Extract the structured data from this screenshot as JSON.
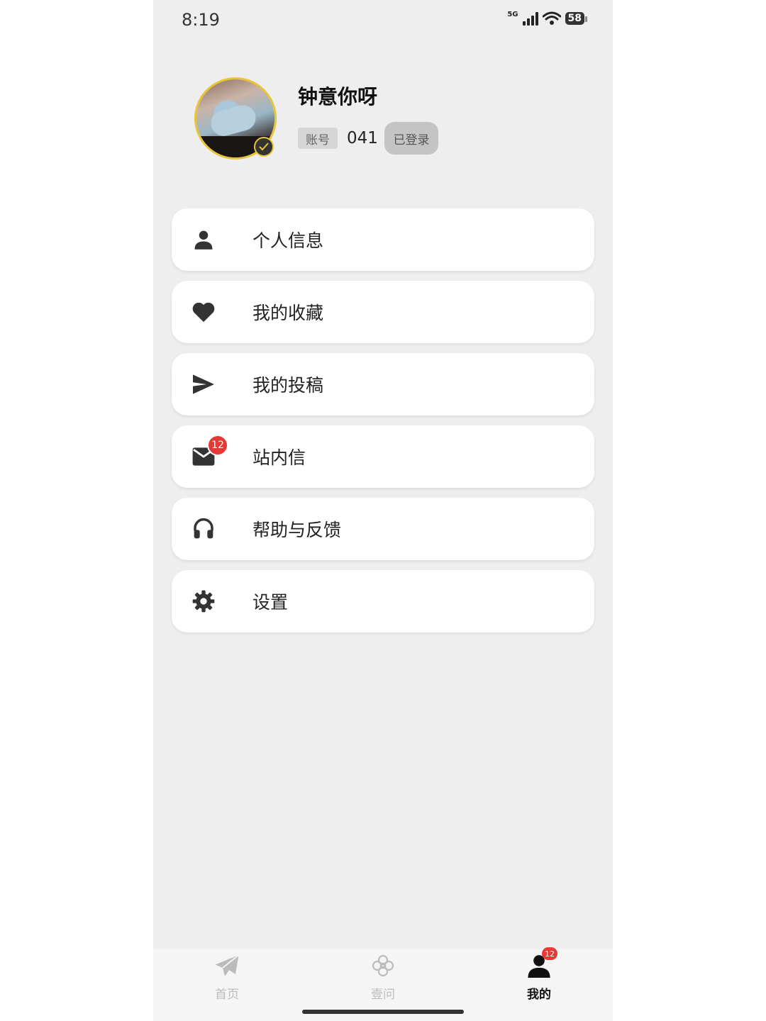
{
  "status": {
    "time": "8:19",
    "network": "5G",
    "battery": "58"
  },
  "profile": {
    "nickname": "钟意你呀",
    "account_tag": "账号",
    "account_no": "041",
    "login_status": "已登录"
  },
  "menu": [
    {
      "label": "个人信息",
      "icon": "person-icon"
    },
    {
      "label": "我的收藏",
      "icon": "heart-icon"
    },
    {
      "label": "我的投稿",
      "icon": "send-icon"
    },
    {
      "label": "站内信",
      "icon": "mail-icon",
      "badge": "12"
    },
    {
      "label": "帮助与反馈",
      "icon": "headphones-icon"
    },
    {
      "label": "设置",
      "icon": "gear-icon"
    }
  ],
  "tabs": [
    {
      "label": "首页",
      "icon": "paper-plane-icon"
    },
    {
      "label": "壹问",
      "icon": "flower-icon"
    },
    {
      "label": "我的",
      "icon": "user-icon",
      "badge": "12",
      "active": true
    }
  ],
  "colors": {
    "background": "#eeeeee",
    "card": "#ffffff",
    "accent_gold": "#e8c43a",
    "badge_red": "#e53935",
    "icon_dark": "#333333"
  }
}
